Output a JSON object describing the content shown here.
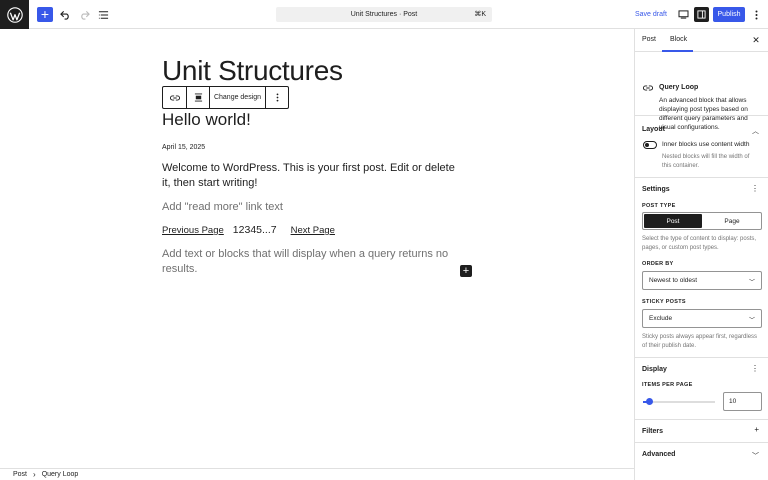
{
  "topbar": {
    "command_title": "Unit Structures · Post",
    "command_shortcut": "⌘K",
    "save_draft": "Save draft",
    "publish": "Publish"
  },
  "post": {
    "title": "Unit Structures"
  },
  "block_toolbar": {
    "change_design": "Change design"
  },
  "query": {
    "item_title": "Hello world!",
    "item_date": "April 15, 2025",
    "item_excerpt": "Welcome to WordPress. This is your first post. Edit or delete it, then start writing!",
    "read_more": "Add \"read more\" link text",
    "pagination": {
      "previous": "Previous Page",
      "numbers": "12345...7",
      "next": "Next Page"
    },
    "no_results": "Add text or blocks that will display when a query returns no results."
  },
  "breadcrumb": {
    "items": [
      "Post",
      "Query Loop"
    ]
  },
  "sidebar": {
    "tabs": [
      "Post",
      "Block"
    ],
    "active_tab": "Block",
    "block_card": {
      "title": "Query Loop",
      "description": "An advanced block that allows displaying post types based on different query parameters and visual configurations."
    },
    "layout": {
      "title": "Layout",
      "toggle_label": "Inner blocks use content width",
      "toggle_help": "Nested blocks will fill the width of this container."
    },
    "settings": {
      "title": "Settings",
      "post_type_label": "Post type",
      "post_type_options": [
        "Post",
        "Page"
      ],
      "post_type_selected": "Post",
      "post_type_help": "Select the type of content to display: posts, pages, or custom post types.",
      "order_by_label": "Order by",
      "order_by_value": "Newest to oldest",
      "sticky_label": "Sticky posts",
      "sticky_value": "Exclude",
      "sticky_help": "Sticky posts always appear first, regardless of their publish date."
    },
    "display": {
      "title": "Display",
      "items_per_page_label": "Items per page",
      "items_per_page_value": "10",
      "items_per_page_fraction": 0.09
    },
    "filters": {
      "title": "Filters"
    },
    "advanced": {
      "title": "Advanced"
    }
  },
  "colors": {
    "accent": "#3858e9",
    "dark": "#1e1e1e"
  }
}
